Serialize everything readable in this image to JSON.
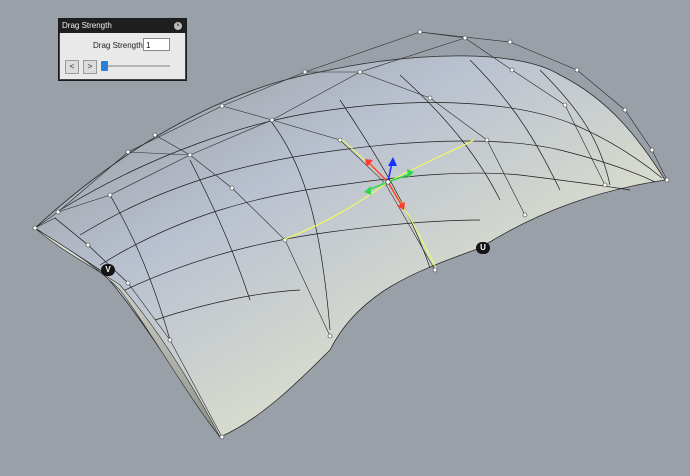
{
  "panel": {
    "title": "Drag Strength",
    "close_icon": "close-icon",
    "strength_label": "Drag Strength:",
    "strength_value": "1",
    "prev_label": "<",
    "next_label": ">",
    "slider_fraction": 0.0
  },
  "labels": {
    "v": "V",
    "u": "U"
  },
  "colors": {
    "background": "#9aa0a8",
    "surface_light": "#e6e8e0",
    "surface_blue": "#8f9ab0",
    "surface_shadow": "#3d4238",
    "isoline_selected": "#f5ff55",
    "gumball_x": "#ff3b30",
    "gumball_y": "#2fd84c",
    "gumball_z": "#1632ff",
    "panel_title_bg": "#1f1f1f"
  }
}
